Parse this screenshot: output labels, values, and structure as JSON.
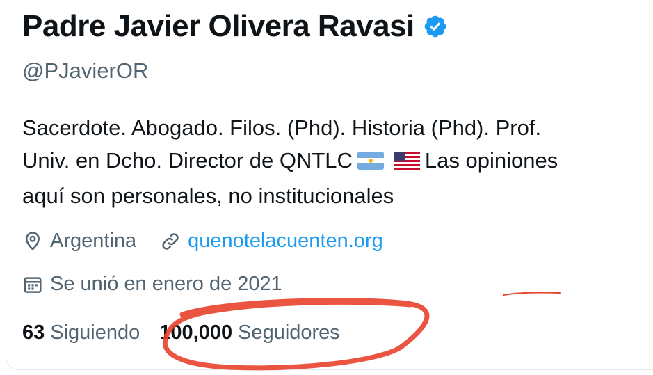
{
  "profile": {
    "display_name": "Padre Javier Olivera Ravasi",
    "handle": "@PJavierOR",
    "verified_icon": "verified-badge-icon",
    "bio_line_1": "Sacerdote. Abogado. Filos. (Phd). Historia (Phd). Prof.",
    "bio_line_2_a": "Univ. en Dcho. Director de QNTLC",
    "bio_line_2_b": "Las opiniones",
    "bio_line_3": "aquí son personales, no institucionales",
    "location": "Argentina",
    "website": "quenotelacuenten.org",
    "joined": "Se unió en enero de 2021",
    "following_count": "63",
    "following_label": "Siguiendo",
    "followers_count": "100,000",
    "followers_label": "Seguidores"
  },
  "colors": {
    "text": "#0f1419",
    "secondary": "#536471",
    "link": "#1d9bf0",
    "verified": "#1d9bf0",
    "annotation": "#e8412c"
  },
  "icons": [
    "location-icon",
    "link-icon",
    "calendar-icon",
    "argentina-flag-icon",
    "usa-flag-icon"
  ]
}
